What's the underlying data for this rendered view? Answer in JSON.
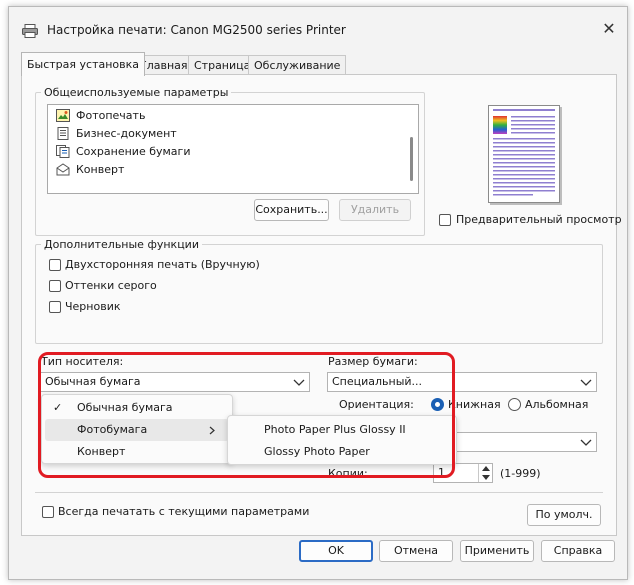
{
  "window": {
    "title": "Настройка печати: Canon MG2500 series Printer",
    "close_glyph": "✕"
  },
  "tabs": [
    {
      "label": "Быстрая установка",
      "active": true
    },
    {
      "label": "Главная",
      "active": false
    },
    {
      "label": "Страница",
      "active": false
    },
    {
      "label": "Обслуживание",
      "active": false
    }
  ],
  "presets": {
    "group_label": "Общеиспользуемые параметры",
    "items": [
      {
        "label": "Фотопечать",
        "icon": "photo-print-icon"
      },
      {
        "label": "Бизнес-документ",
        "icon": "document-icon"
      },
      {
        "label": "Сохранение бумаги",
        "icon": "paper-saving-icon"
      },
      {
        "label": "Конверт",
        "icon": "envelope-icon"
      }
    ],
    "save_label": "Сохранить...",
    "delete_label": "Удалить"
  },
  "preview": {
    "checkbox_label": "Предварительный просмотр",
    "checked": false
  },
  "extra": {
    "group_label": "Дополнительные функции",
    "options": [
      {
        "label": "Двухсторонняя печать (Вручную)",
        "checked": false
      },
      {
        "label": "Оттенки серого",
        "checked": false
      },
      {
        "label": "Черновик",
        "checked": false
      }
    ]
  },
  "media": {
    "label": "Тип носителя:",
    "value": "Обычная бумага",
    "menu": [
      {
        "label": "Обычная бумага",
        "checked": true,
        "submenu": false
      },
      {
        "label": "Фотобумага",
        "checked": false,
        "submenu": true
      },
      {
        "label": "Конверт",
        "checked": false,
        "submenu": false
      }
    ],
    "submenu": [
      "Photo Paper Plus Glossy II",
      "Glossy Photo Paper"
    ]
  },
  "paper_size": {
    "label": "Размер бумаги:",
    "value": "Специальный..."
  },
  "orientation": {
    "label": "Ориентация:",
    "portrait": "Книжная",
    "landscape": "Альбомная",
    "selected": "portrait"
  },
  "copies": {
    "label": "Копии:",
    "value": "1",
    "range": "(1-999)"
  },
  "always_print": {
    "label": "Всегда печатать с текущими параметрами",
    "checked": false
  },
  "buttons": {
    "defaults": "По умолч.",
    "ok": "OK",
    "cancel": "Отмена",
    "apply": "Применить",
    "help": "Справка"
  },
  "colors": {
    "highlight": "#e11b22",
    "accent": "#1a5fb4",
    "default_button_border": "#2b6bc5"
  }
}
